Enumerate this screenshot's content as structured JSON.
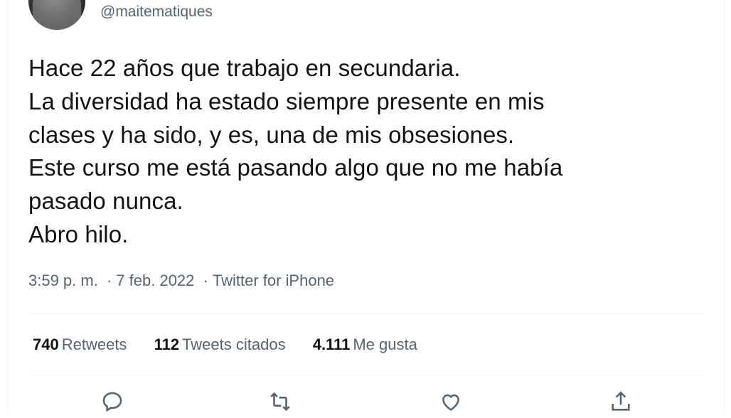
{
  "author": {
    "handle": "@maitematiques",
    "avatar_icon": "profile-photo"
  },
  "tweet": {
    "lines": [
      "Hace 22 años que trabajo en secundaria.",
      "La diversidad ha estado siempre presente en mis",
      "clases y ha sido, y es, una de mis obsesiones.",
      "Este curso me está pasando algo que no me había",
      "pasado nunca.",
      "Abro hilo."
    ]
  },
  "meta": {
    "time": "3:59 p. m.",
    "date": "7 feb. 2022",
    "separator": "·",
    "source": "Twitter for iPhone"
  },
  "stats": {
    "retweets_count": "740",
    "retweets_label": "Retweets",
    "quotes_count": "112",
    "quotes_label": "Tweets citados",
    "likes_count": "4.111",
    "likes_label": "Me gusta"
  },
  "actions": {
    "icons": [
      "reply-icon",
      "retweet-icon",
      "like-icon",
      "share-icon"
    ],
    "icon_color": "#536471"
  },
  "colors": {
    "text": "#0f1419",
    "secondary": "#536471",
    "divider": "#eff3f4"
  }
}
